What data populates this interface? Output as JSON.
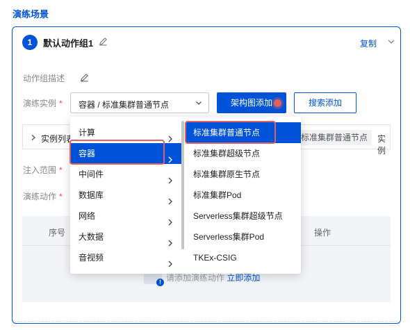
{
  "page_title": "演练场景",
  "group": {
    "index": "1",
    "name": "默认动作组1",
    "copy_label": "复制"
  },
  "form": {
    "desc_label": "动作组描述",
    "instance_label": "演练实例",
    "required_mark": "*",
    "select_value": "容器 / 标准集群普通节点",
    "architecture_button": "架构图添加",
    "search_button": "搜索添加",
    "instance_list_label": "实例列表",
    "instance_tag": "标准集群普通节点",
    "instance_tail": "实例",
    "inject_label": "注入范围",
    "action_label": "演练动作"
  },
  "table": {
    "col_index": "序号",
    "col_ops": "操作",
    "empty_text": "请添加演练动作",
    "empty_link": "立即添加"
  },
  "cascader": {
    "level1": [
      "计算",
      "容器",
      "中间件",
      "数据库",
      "网络",
      "大数据",
      "音视频"
    ],
    "level1_active_index": 1,
    "level2": [
      "标准集群普通节点",
      "标准集群超级节点",
      "标准集群原生节点",
      "标准集群Pod",
      "Serverless集群超级节点",
      "Serverless集群Pod",
      "TKEx-CSIG"
    ],
    "level2_active_index": 0
  },
  "colors": {
    "primary": "#0052d9",
    "highlight": "#e0605e",
    "required": "#e34d59"
  },
  "icons": {
    "edit": "pencil-icon",
    "collapse": "chevron-down-icon",
    "expand": "chevron-right-icon",
    "caret": "chevron-down-icon",
    "record": "record-dot-icon"
  }
}
